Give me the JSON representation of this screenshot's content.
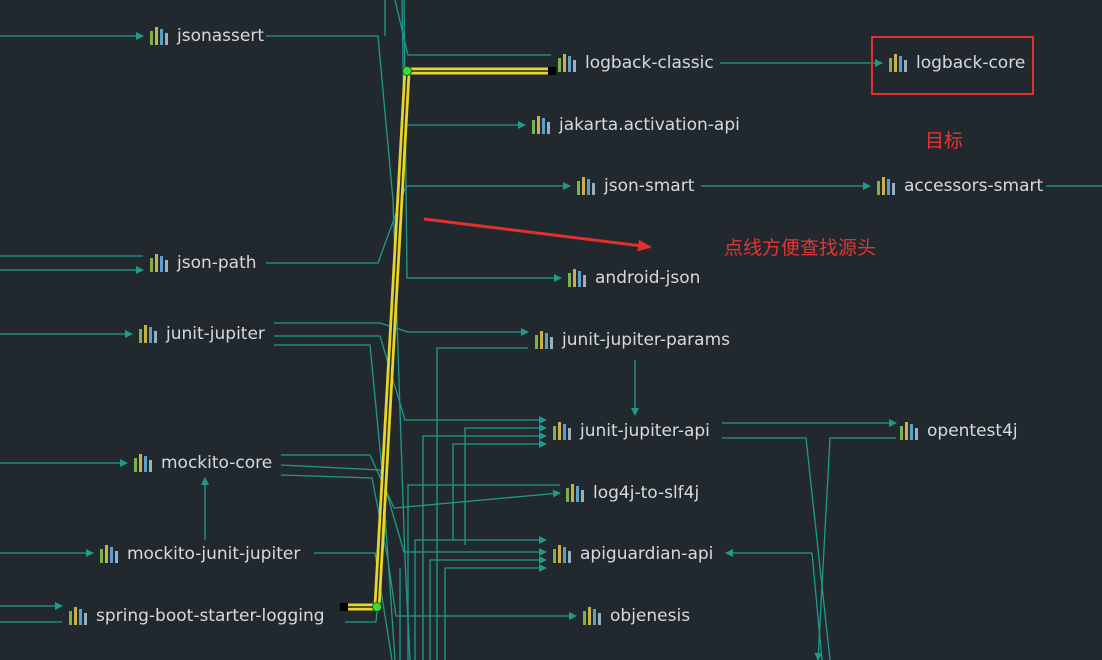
{
  "nodes": [
    {
      "id": "jsonassert",
      "label": "jsonassert"
    },
    {
      "id": "json-path",
      "label": "json-path"
    },
    {
      "id": "junit-jupiter",
      "label": "junit-jupiter"
    },
    {
      "id": "mockito-core",
      "label": "mockito-core"
    },
    {
      "id": "mockito-junit-jupiter",
      "label": "mockito-junit-jupiter"
    },
    {
      "id": "spring-boot-starter-logging",
      "label": "spring-boot-starter-logging"
    },
    {
      "id": "logback-classic",
      "label": "logback-classic"
    },
    {
      "id": "jakarta-activation-api",
      "label": "jakarta.activation-api"
    },
    {
      "id": "json-smart",
      "label": "json-smart"
    },
    {
      "id": "android-json",
      "label": "android-json"
    },
    {
      "id": "junit-jupiter-params",
      "label": "junit-jupiter-params"
    },
    {
      "id": "junit-jupiter-api",
      "label": "junit-jupiter-api"
    },
    {
      "id": "log4j-to-slf4j",
      "label": "log4j-to-slf4j"
    },
    {
      "id": "apiguardian-api",
      "label": "apiguardian-api"
    },
    {
      "id": "objenesis",
      "label": "objenesis"
    },
    {
      "id": "logback-core",
      "label": "logback-core"
    },
    {
      "id": "accessors-smart",
      "label": "accessors-smart"
    },
    {
      "id": "opentest4j",
      "label": "opentest4j"
    }
  ],
  "annotations": {
    "target_label": "目标",
    "hint_label": "点线方便查找源头"
  },
  "highlight": {
    "from": "spring-boot-starter-logging",
    "to": "logback-classic",
    "color": "#e8d42a"
  },
  "colors": {
    "background": "#22292e",
    "edge": "#1f9a8a",
    "annotation": "#e03535",
    "node_text": "#d6dadd",
    "icon_bars": [
      "#7fb04a",
      "#c9b04a",
      "#5aa0c8",
      "#9ab0c0"
    ]
  }
}
